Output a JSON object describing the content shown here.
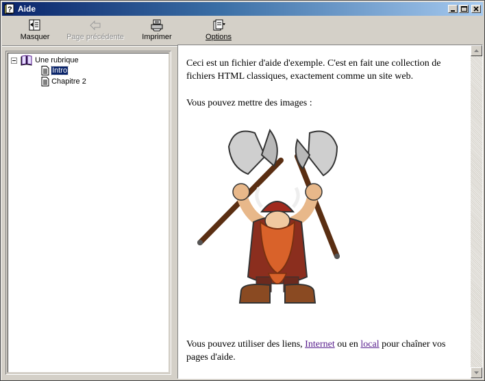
{
  "window": {
    "title": "Aide"
  },
  "toolbar": {
    "hide_label": "Masquer",
    "back_label": "Page précédente",
    "print_label": "Imprimer",
    "options_label": "Options"
  },
  "tree": {
    "root_label": "Une rubrique",
    "items": [
      {
        "label": "Intro",
        "selected": true
      },
      {
        "label": "Chapitre 2",
        "selected": false
      }
    ]
  },
  "content": {
    "para1": "Ceci est un fichier d'aide d'exemple. C'est en fait une collection de fichiers HTML classiques, exactement comme un site web.",
    "para2": "Vous pouvez mettre des images :",
    "para3_before": "Vous pouvez utiliser des liens, ",
    "link_internet": "Internet",
    "para3_mid": " ou en ",
    "link_local": "local",
    "para3_after": " pour chaîner vos pages d'aide."
  },
  "colors": {
    "title_bar": "#0a246a",
    "link": "#551a8b",
    "face": "#d4d0c8"
  },
  "icons": [
    "help-book-icon",
    "minimize-icon",
    "maximize-icon",
    "close-icon",
    "hide-icon",
    "back-arrow-icon",
    "printer-icon",
    "options-icon",
    "book-open-icon",
    "page-icon"
  ]
}
